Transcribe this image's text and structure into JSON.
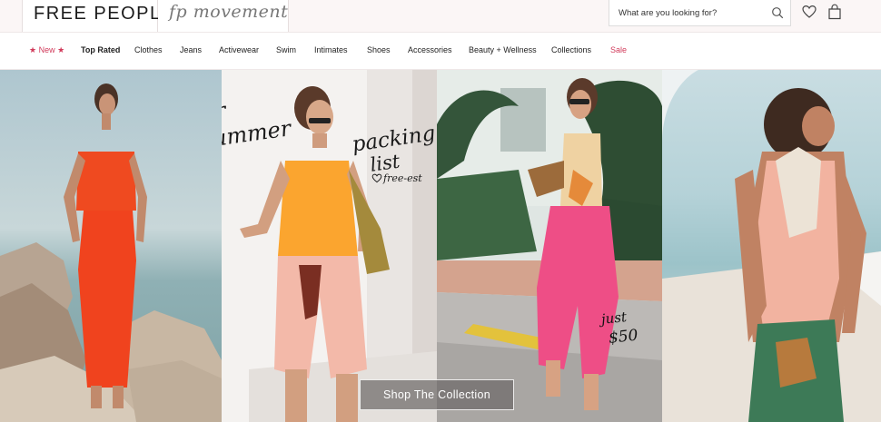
{
  "header": {
    "brand": "FREE PEOPLE",
    "sub_brand": "fp movement",
    "search": {
      "placeholder": "What are you looking for?"
    }
  },
  "icons": {
    "search": "search-icon",
    "wishlist": "heart-icon",
    "cart": "shopping-bag-icon"
  },
  "nav": {
    "new": "New",
    "top_rated": "Top Rated",
    "clothes": "Clothes",
    "jeans": "Jeans",
    "activewear": "Activewear",
    "swim": "Swim",
    "intimates": "Intimates",
    "shoes": "Shoes",
    "accessories": "Accessories",
    "beauty": "Beauty + Wellness",
    "collections": "Collections",
    "sale": "Sale"
  },
  "hero": {
    "headline_line1": "your",
    "headline_line2": "summer",
    "headline_line3": "packing",
    "headline_line4": "list",
    "signature": "free-est",
    "price_line1": "just",
    "price_line2": "$50",
    "cta_label": "Shop The Collection"
  },
  "colors": {
    "accent": "#d13a5a",
    "header_bg": "#fbf6f6"
  }
}
